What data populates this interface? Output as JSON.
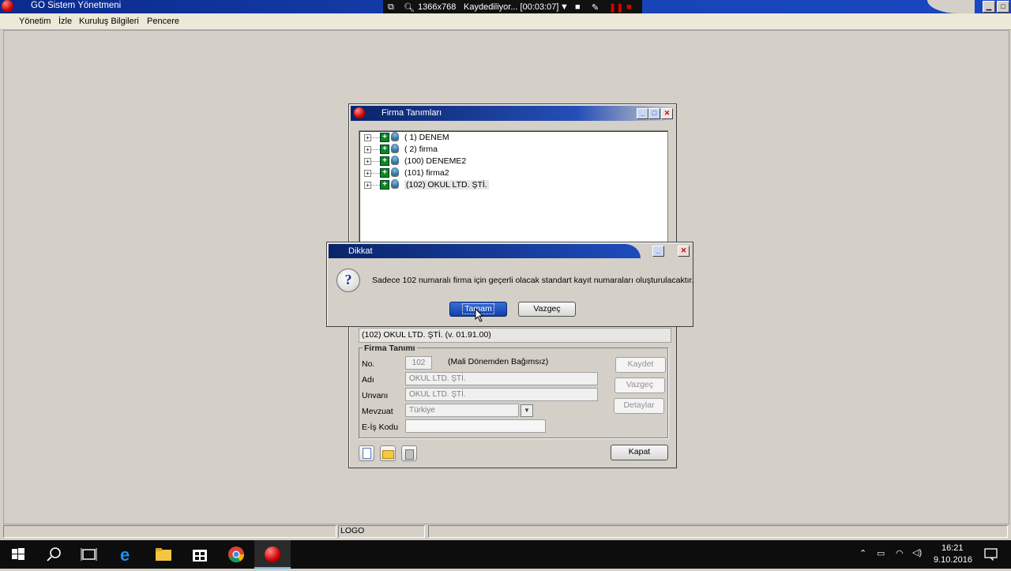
{
  "app": {
    "title": "GO Sistem Yönetmeni",
    "menu": [
      "Yönetim",
      "İzle",
      "Kuruluş Bilgileri",
      "Pencere"
    ]
  },
  "recorder": {
    "resolution": "1366x768",
    "status": "Kaydediliyor... [00:03:07]"
  },
  "firma_window": {
    "title": "Firma Tanımları",
    "tree": [
      "( 1) DENEM",
      "( 2) firma",
      "(100) DENEME2",
      "(101) firma2",
      "(102) OKUL LTD. ŞTİ."
    ],
    "selected_info": "(102) OKUL LTD. ŞTİ.  (v. 01.91.00)",
    "group_title": "Firma Tanımı",
    "fields": {
      "no_label": "No.",
      "no_value": "102",
      "no_note": "(Mali Dönemden Bağımsız)",
      "adi_label": "Adı",
      "adi_value": "OKUL LTD. ŞTİ.",
      "unvani_label": "Unvanı",
      "unvani_value": "OKUL LTD. ŞTİ.",
      "mevzuat_label": "Mevzuat",
      "mevzuat_value": "Türkiye",
      "eis_label": "E-İş Kodu",
      "eis_value": ""
    },
    "buttons": {
      "kaydet": "Kaydet",
      "vazgec": "Vazgeç",
      "detaylar": "Detaylar",
      "kapat": "Kapat"
    }
  },
  "dialog": {
    "title": "Dikkat",
    "message": "Sadece 102 numaralı firma için geçerli olacak standart kayıt numaraları oluşturulacaktır.",
    "ok_label": "Tamam",
    "cancel_label": "Vazgeç"
  },
  "status_bar": {
    "label": "LOGO"
  },
  "taskbar": {
    "time": "16:21",
    "date": "9.10.2016"
  },
  "colors": {
    "title_blue": "#0a246a",
    "window_bg": "#d4d0c8",
    "taskbar": "#0d0d0d"
  }
}
